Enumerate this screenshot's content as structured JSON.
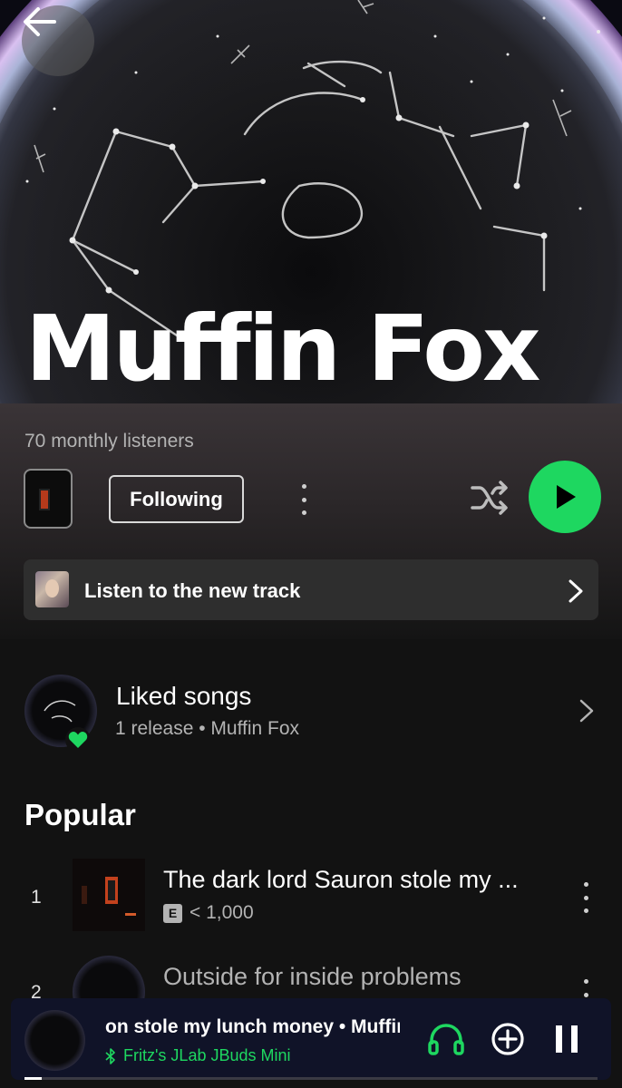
{
  "colors": {
    "accent": "#1ed760",
    "background": "#121212",
    "card": "#2e2e2e",
    "mini_player": "#101328"
  },
  "header": {
    "back_icon": "arrow-left-icon",
    "artist_name": "Muffin Fox",
    "monthly_listeners": "70 monthly listeners",
    "follow_label": "Following",
    "more_icon": "more-vertical-icon",
    "shuffle_icon": "shuffle-icon",
    "play_icon": "play-icon"
  },
  "new_track_banner": {
    "label": "Listen to the new track",
    "chevron_icon": "chevron-right-icon"
  },
  "liked_songs": {
    "title": "Liked songs",
    "subtitle": "1 release • Muffin Fox",
    "badge_icon": "heart-icon"
  },
  "popular": {
    "heading": "Popular",
    "tracks": [
      {
        "rank": "1",
        "title": "The dark lord Sauron stole my ...",
        "explicit_label": "E",
        "plays": "< 1,000"
      },
      {
        "rank": "2",
        "title": "Outside for inside problems"
      }
    ]
  },
  "mini_player": {
    "now_playing": "on stole my lunch money • Muffin Fox",
    "device_icon": "bluetooth-icon",
    "device": "Fritz's JLab JBuds Mini",
    "connect_icon": "headphones-icon",
    "add_icon": "plus-circle-icon",
    "pause_icon": "pause-icon",
    "progress_fraction": 0.03
  }
}
